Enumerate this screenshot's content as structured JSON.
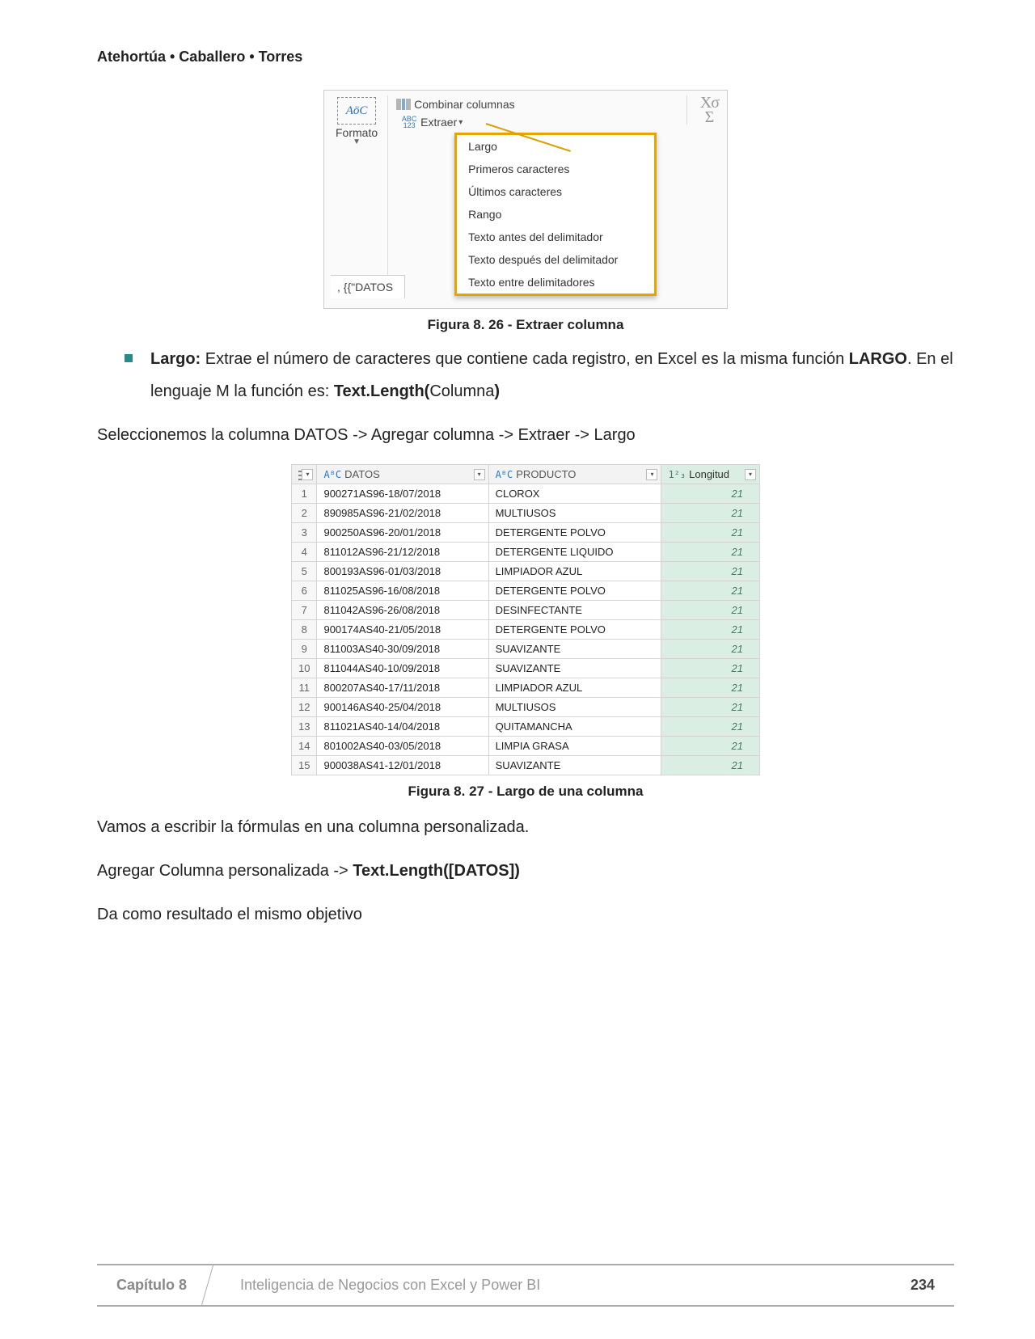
{
  "header_authors": "Atehortúa • Caballero • Torres",
  "ribbon": {
    "formato_label": "Formato",
    "combinar_label": "Combinar columnas",
    "extraer_label": "Extraer",
    "stats_top": "Χσ",
    "stats_sigma": "Σ",
    "menu_items": [
      "Largo",
      "Primeros caracteres",
      "Últimos caracteres",
      "Rango",
      "Texto antes del delimitador",
      "Texto después del delimitador",
      "Texto entre delimitadores"
    ],
    "formula_hint": ", {{\"DATOS"
  },
  "caption_26": "Figura 8. 26 - Extraer columna",
  "bullet": {
    "largo_label": "Largo:",
    "largo_text_1": " Extrae el número de caracteres que contiene  cada registro, en Excel es la misma función ",
    "largo_bold": "LARGO",
    "largo_text_2": ". En el lenguaje M la función es: ",
    "largo_func": "Text.Length(",
    "largo_col": "Columna",
    "largo_close": ")"
  },
  "para_select": "Seleccionemos la columna DATOS -> Agregar columna -> Extraer -> Largo",
  "table": {
    "headers": {
      "idx_aria": "index",
      "datos_type": "AᴮC",
      "datos": "DATOS",
      "producto_type": "AᴮC",
      "producto": "PRODUCTO",
      "longitud_type": "1²₃",
      "longitud": "Longitud"
    },
    "rows": [
      {
        "n": "1",
        "d": "900271AS96-18/07/2018",
        "p": "CLOROX",
        "l": "21"
      },
      {
        "n": "2",
        "d": "890985AS96-21/02/2018",
        "p": "MULTIUSOS",
        "l": "21"
      },
      {
        "n": "3",
        "d": "900250AS96-20/01/2018",
        "p": "DETERGENTE POLVO",
        "l": "21"
      },
      {
        "n": "4",
        "d": "811012AS96-21/12/2018",
        "p": "DETERGENTE LIQUIDO",
        "l": "21"
      },
      {
        "n": "5",
        "d": "800193AS96-01/03/2018",
        "p": "LIMPIADOR AZUL",
        "l": "21"
      },
      {
        "n": "6",
        "d": "811025AS96-16/08/2018",
        "p": "DETERGENTE POLVO",
        "l": "21"
      },
      {
        "n": "7",
        "d": "811042AS96-26/08/2018",
        "p": "DESINFECTANTE",
        "l": "21"
      },
      {
        "n": "8",
        "d": "900174AS40-21/05/2018",
        "p": "DETERGENTE POLVO",
        "l": "21"
      },
      {
        "n": "9",
        "d": "811003AS40-30/09/2018",
        "p": "SUAVIZANTE",
        "l": "21"
      },
      {
        "n": "10",
        "d": "811044AS40-10/09/2018",
        "p": "SUAVIZANTE",
        "l": "21"
      },
      {
        "n": "11",
        "d": "800207AS40-17/11/2018",
        "p": "LIMPIADOR AZUL",
        "l": "21"
      },
      {
        "n": "12",
        "d": "900146AS40-25/04/2018",
        "p": "MULTIUSOS",
        "l": "21"
      },
      {
        "n": "13",
        "d": "811021AS40-14/04/2018",
        "p": "QUITAMANCHA",
        "l": "21"
      },
      {
        "n": "14",
        "d": "801002AS40-03/05/2018",
        "p": "LIMPIA GRASA",
        "l": "21"
      },
      {
        "n": "15",
        "d": "900038AS41-12/01/2018",
        "p": "SUAVIZANTE",
        "l": "21"
      }
    ]
  },
  "caption_27": "Figura 8. 27 - Largo de una columna",
  "para_formula": "Vamos a escribir la fórmulas en una columna personalizada.",
  "para_addcol_1": "Agregar Columna personalizada -> ",
  "para_addcol_bold": "Text.Length([DATOS])",
  "para_result": "Da como resultado el mismo objetivo",
  "footer": {
    "chapter": "Capítulo 8",
    "title": "Inteligencia de Negocios con Excel y Power BI",
    "page": "234"
  }
}
